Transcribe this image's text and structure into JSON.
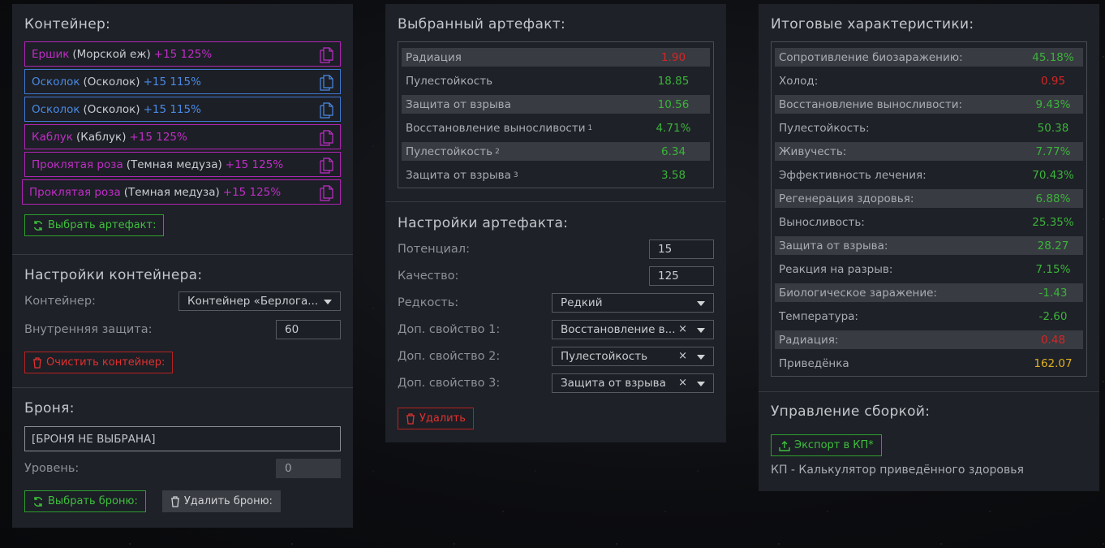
{
  "colors": {
    "accent_green": "#3bb33b",
    "accent_red": "#d42626",
    "accent_yellow": "#e0b020",
    "purple": "#c02dc7",
    "blue": "#4a8ae6",
    "panel": "#1e2127"
  },
  "container": {
    "title": "Контейнер:",
    "items": [
      {
        "name": "Ершик",
        "base": "(Морской еж)",
        "level": "+15 125%",
        "color": "purple",
        "icon": "document-icon"
      },
      {
        "name": "Осколок",
        "base": "(Осколок)",
        "level": "+15 115%",
        "color": "blue",
        "icon": "document-icon"
      },
      {
        "name": "Осколок",
        "base": "(Осколок)",
        "level": "+15 115%",
        "color": "blue",
        "icon": "document-icon"
      },
      {
        "name": "Каблук",
        "base": "(Каблук)",
        "level": "+15 125%",
        "color": "purple",
        "icon": "document-icon"
      },
      {
        "name": "Проклятая роза",
        "base": "(Темная медуза)",
        "level": "+15 125%",
        "color": "purple",
        "icon": "document-icon"
      },
      {
        "name": "Проклятая роза",
        "base": "(Темная медуза)",
        "level": "+15 125%",
        "color": "purple",
        "icon": "document-icon"
      }
    ],
    "choose_button": "Выбрать артефакт:"
  },
  "container_settings": {
    "title": "Настройки контейнера:",
    "container_label": "Контейнер:",
    "container_value": "Контейнер «Берлога...",
    "protection_label": "Внутренняя защита:",
    "protection_value": "60",
    "clear_button": "Очистить контейнер:"
  },
  "armor": {
    "title": "Броня:",
    "field_value": "[БРОНЯ НЕ ВЫБРАНА]",
    "level_label": "Уровень:",
    "level_value": "0",
    "choose_button": "Выбрать броню:",
    "delete_button": "Удалить броню:"
  },
  "selected_artifact": {
    "title": "Выбранный артефакт:",
    "stats": [
      {
        "label": "Радиация",
        "sup": "",
        "value": "1.90",
        "color": "r"
      },
      {
        "label": "Пулестойкость",
        "sup": "",
        "value": "18.85",
        "color": "g"
      },
      {
        "label": "Защита от взрыва",
        "sup": "",
        "value": "10.56",
        "color": "g"
      },
      {
        "label": "Восстановление выносливости",
        "sup": "1",
        "value": "4.71%",
        "color": "g"
      },
      {
        "label": "Пулестойкость",
        "sup": "2",
        "value": "6.34",
        "color": "g"
      },
      {
        "label": "Защита от взрыва",
        "sup": "3",
        "value": "3.58",
        "color": "g"
      }
    ]
  },
  "artifact_settings": {
    "title": "Настройки артефакта:",
    "potential_label": "Потенциал:",
    "potential_value": "15",
    "quality_label": "Качество:",
    "quality_value": "125",
    "rarity_label": "Редкость:",
    "rarity_value": "Редкий",
    "prop1_label": "Доп. свойство 1:",
    "prop1_value": "Восстановление в...",
    "prop2_label": "Доп. свойство 2:",
    "prop2_value": "Пулестойкость",
    "prop3_label": "Доп. свойство 3:",
    "prop3_value": "Защита от взрыва",
    "clear_symbol": "×",
    "delete_button": "Удалить"
  },
  "summary": {
    "title": "Итоговые характеристики:",
    "stats": [
      {
        "label": "Сопротивление биозаражению:",
        "value": "45.18%",
        "color": "g"
      },
      {
        "label": "Холод:",
        "value": "0.95",
        "color": "r"
      },
      {
        "label": "Восстановление выносливости:",
        "value": "9.43%",
        "color": "g"
      },
      {
        "label": "Пулестойкость:",
        "value": "50.38",
        "color": "g"
      },
      {
        "label": "Живучесть:",
        "value": "7.77%",
        "color": "g"
      },
      {
        "label": "Эффективность лечения:",
        "value": "70.43%",
        "color": "g"
      },
      {
        "label": "Регенерация здоровья:",
        "value": "6.88%",
        "color": "g"
      },
      {
        "label": "Выносливость:",
        "value": "25.35%",
        "color": "g"
      },
      {
        "label": "Защита от взрыва:",
        "value": "28.27",
        "color": "g"
      },
      {
        "label": "Реакция на разрыв:",
        "value": "7.15%",
        "color": "g"
      },
      {
        "label": "Биологическое заражение:",
        "value": "-1.43",
        "color": "g"
      },
      {
        "label": "Температура:",
        "value": "-2.60",
        "color": "g"
      },
      {
        "label": "Радиация:",
        "value": "0.48",
        "color": "r"
      },
      {
        "label": "Приведёнка",
        "value": "162.07",
        "color": "y"
      }
    ]
  },
  "build": {
    "title": "Управление сборкой:",
    "export_button": "Экспорт в КП*",
    "note": "КП - Калькулятор приведённого здоровья"
  }
}
